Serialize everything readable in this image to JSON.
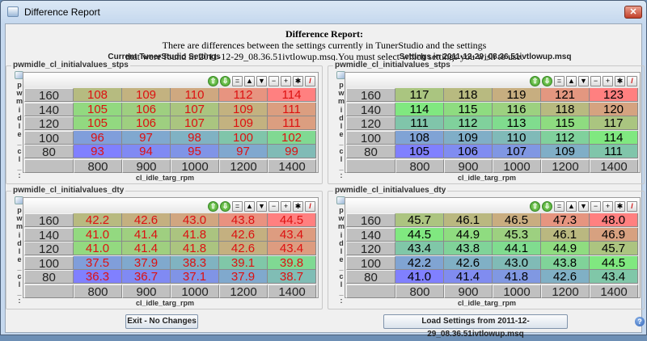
{
  "window": {
    "title": "Difference Report",
    "close_glyph": "✕"
  },
  "header": {
    "title": "Difference Report:",
    "line1": "There are differences between the settings currently in TunerStudio and the settings",
    "line2": "that were found in 2011-12-29_08.36.51ivtlowup.msq.You must select which settings you wish to use."
  },
  "columns": {
    "left": "Current TunerStudio Settings",
    "right": "Settings in 2011-12-29_08.36.51ivtlowup.msq"
  },
  "toolbar_icons": [
    "increase-icon",
    "decrease-icon",
    "equals-icon",
    "up-icon",
    "down-icon",
    "minus-icon",
    "plus-icon",
    "multiply-icon",
    "pen-icon"
  ],
  "toolbar_glyphs": [
    "⇧",
    "⇩",
    "=",
    "▲",
    "▼",
    "−",
    "+",
    "✱",
    "/"
  ],
  "y_axis_label": "pwmidle_cl_:",
  "x_axis_label": "cl_idle_targ_rpm",
  "row_headers": [
    "160",
    "140",
    "120",
    "100",
    "80"
  ],
  "col_headers": [
    "800",
    "900",
    "1000",
    "1200",
    "1400"
  ],
  "colors": {
    "low": "#8080ff",
    "mid": "#80e880",
    "high": "#ff8080",
    "left_text": "#dd1111",
    "right_text": "#000000"
  },
  "tables": [
    {
      "side": "left",
      "title": "pwmidle_cl_initialvalues_stps",
      "values": [
        [
          "108",
          "109",
          "110",
          "112",
          "114"
        ],
        [
          "105",
          "106",
          "107",
          "109",
          "111"
        ],
        [
          "105",
          "106",
          "107",
          "109",
          "111"
        ],
        [
          "96",
          "97",
          "98",
          "100",
          "102"
        ],
        [
          "93",
          "94",
          "95",
          "97",
          "99"
        ]
      ]
    },
    {
      "side": "right",
      "title": "pwmidle_cl_initialvalues_stps",
      "values": [
        [
          "117",
          "118",
          "119",
          "121",
          "123"
        ],
        [
          "114",
          "115",
          "116",
          "118",
          "120"
        ],
        [
          "111",
          "112",
          "113",
          "115",
          "117"
        ],
        [
          "108",
          "109",
          "110",
          "112",
          "114"
        ],
        [
          "105",
          "106",
          "107",
          "109",
          "111"
        ]
      ]
    },
    {
      "side": "left",
      "title": "pwmidle_cl_initialvalues_dty",
      "values": [
        [
          "42.2",
          "42.6",
          "43.0",
          "43.8",
          "44.5"
        ],
        [
          "41.0",
          "41.4",
          "41.8",
          "42.6",
          "43.4"
        ],
        [
          "41.0",
          "41.4",
          "41.8",
          "42.6",
          "43.4"
        ],
        [
          "37.5",
          "37.9",
          "38.3",
          "39.1",
          "39.8"
        ],
        [
          "36.3",
          "36.7",
          "37.1",
          "37.9",
          "38.7"
        ]
      ]
    },
    {
      "side": "right",
      "title": "pwmidle_cl_initialvalues_dty",
      "values": [
        [
          "45.7",
          "46.1",
          "46.5",
          "47.3",
          "48.0"
        ],
        [
          "44.5",
          "44.9",
          "45.3",
          "46.1",
          "46.9"
        ],
        [
          "43.4",
          "43.8",
          "44.1",
          "44.9",
          "45.7"
        ],
        [
          "42.2",
          "42.6",
          "43.0",
          "43.8",
          "44.5"
        ],
        [
          "41.0",
          "41.4",
          "41.8",
          "42.6",
          "43.4"
        ]
      ]
    }
  ],
  "buttons": {
    "exit": "Exit - No Changes",
    "load": "Load Settings from 2011-12-29_08.36.51ivtlowup.msq",
    "help": "?"
  }
}
